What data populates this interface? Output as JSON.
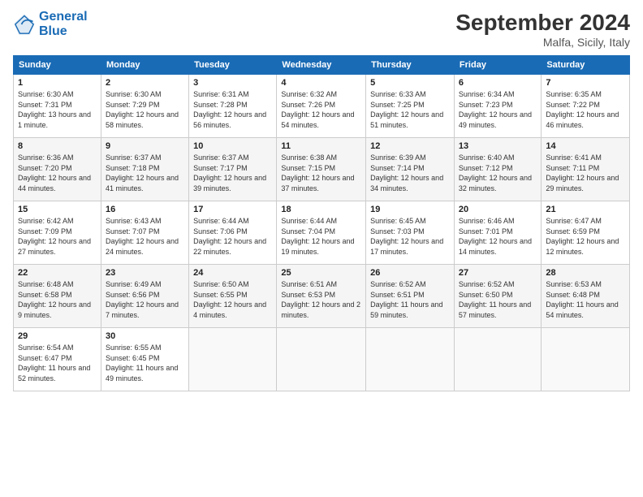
{
  "logo": {
    "line1": "General",
    "line2": "Blue"
  },
  "title": "September 2024",
  "subtitle": "Malfa, Sicily, Italy",
  "days_header": [
    "Sunday",
    "Monday",
    "Tuesday",
    "Wednesday",
    "Thursday",
    "Friday",
    "Saturday"
  ],
  "weeks": [
    [
      {
        "day": "1",
        "sunrise": "6:30 AM",
        "sunset": "7:31 PM",
        "daylight": "13 hours and 1 minute."
      },
      {
        "day": "2",
        "sunrise": "6:30 AM",
        "sunset": "7:29 PM",
        "daylight": "12 hours and 58 minutes."
      },
      {
        "day": "3",
        "sunrise": "6:31 AM",
        "sunset": "7:28 PM",
        "daylight": "12 hours and 56 minutes."
      },
      {
        "day": "4",
        "sunrise": "6:32 AM",
        "sunset": "7:26 PM",
        "daylight": "12 hours and 54 minutes."
      },
      {
        "day": "5",
        "sunrise": "6:33 AM",
        "sunset": "7:25 PM",
        "daylight": "12 hours and 51 minutes."
      },
      {
        "day": "6",
        "sunrise": "6:34 AM",
        "sunset": "7:23 PM",
        "daylight": "12 hours and 49 minutes."
      },
      {
        "day": "7",
        "sunrise": "6:35 AM",
        "sunset": "7:22 PM",
        "daylight": "12 hours and 46 minutes."
      }
    ],
    [
      {
        "day": "8",
        "sunrise": "6:36 AM",
        "sunset": "7:20 PM",
        "daylight": "12 hours and 44 minutes."
      },
      {
        "day": "9",
        "sunrise": "6:37 AM",
        "sunset": "7:18 PM",
        "daylight": "12 hours and 41 minutes."
      },
      {
        "day": "10",
        "sunrise": "6:37 AM",
        "sunset": "7:17 PM",
        "daylight": "12 hours and 39 minutes."
      },
      {
        "day": "11",
        "sunrise": "6:38 AM",
        "sunset": "7:15 PM",
        "daylight": "12 hours and 37 minutes."
      },
      {
        "day": "12",
        "sunrise": "6:39 AM",
        "sunset": "7:14 PM",
        "daylight": "12 hours and 34 minutes."
      },
      {
        "day": "13",
        "sunrise": "6:40 AM",
        "sunset": "7:12 PM",
        "daylight": "12 hours and 32 minutes."
      },
      {
        "day": "14",
        "sunrise": "6:41 AM",
        "sunset": "7:11 PM",
        "daylight": "12 hours and 29 minutes."
      }
    ],
    [
      {
        "day": "15",
        "sunrise": "6:42 AM",
        "sunset": "7:09 PM",
        "daylight": "12 hours and 27 minutes."
      },
      {
        "day": "16",
        "sunrise": "6:43 AM",
        "sunset": "7:07 PM",
        "daylight": "12 hours and 24 minutes."
      },
      {
        "day": "17",
        "sunrise": "6:44 AM",
        "sunset": "7:06 PM",
        "daylight": "12 hours and 22 minutes."
      },
      {
        "day": "18",
        "sunrise": "6:44 AM",
        "sunset": "7:04 PM",
        "daylight": "12 hours and 19 minutes."
      },
      {
        "day": "19",
        "sunrise": "6:45 AM",
        "sunset": "7:03 PM",
        "daylight": "12 hours and 17 minutes."
      },
      {
        "day": "20",
        "sunrise": "6:46 AM",
        "sunset": "7:01 PM",
        "daylight": "12 hours and 14 minutes."
      },
      {
        "day": "21",
        "sunrise": "6:47 AM",
        "sunset": "6:59 PM",
        "daylight": "12 hours and 12 minutes."
      }
    ],
    [
      {
        "day": "22",
        "sunrise": "6:48 AM",
        "sunset": "6:58 PM",
        "daylight": "12 hours and 9 minutes."
      },
      {
        "day": "23",
        "sunrise": "6:49 AM",
        "sunset": "6:56 PM",
        "daylight": "12 hours and 7 minutes."
      },
      {
        "day": "24",
        "sunrise": "6:50 AM",
        "sunset": "6:55 PM",
        "daylight": "12 hours and 4 minutes."
      },
      {
        "day": "25",
        "sunrise": "6:51 AM",
        "sunset": "6:53 PM",
        "daylight": "12 hours and 2 minutes."
      },
      {
        "day": "26",
        "sunrise": "6:52 AM",
        "sunset": "6:51 PM",
        "daylight": "11 hours and 59 minutes."
      },
      {
        "day": "27",
        "sunrise": "6:52 AM",
        "sunset": "6:50 PM",
        "daylight": "11 hours and 57 minutes."
      },
      {
        "day": "28",
        "sunrise": "6:53 AM",
        "sunset": "6:48 PM",
        "daylight": "11 hours and 54 minutes."
      }
    ],
    [
      {
        "day": "29",
        "sunrise": "6:54 AM",
        "sunset": "6:47 PM",
        "daylight": "11 hours and 52 minutes."
      },
      {
        "day": "30",
        "sunrise": "6:55 AM",
        "sunset": "6:45 PM",
        "daylight": "11 hours and 49 minutes."
      },
      null,
      null,
      null,
      null,
      null
    ]
  ]
}
